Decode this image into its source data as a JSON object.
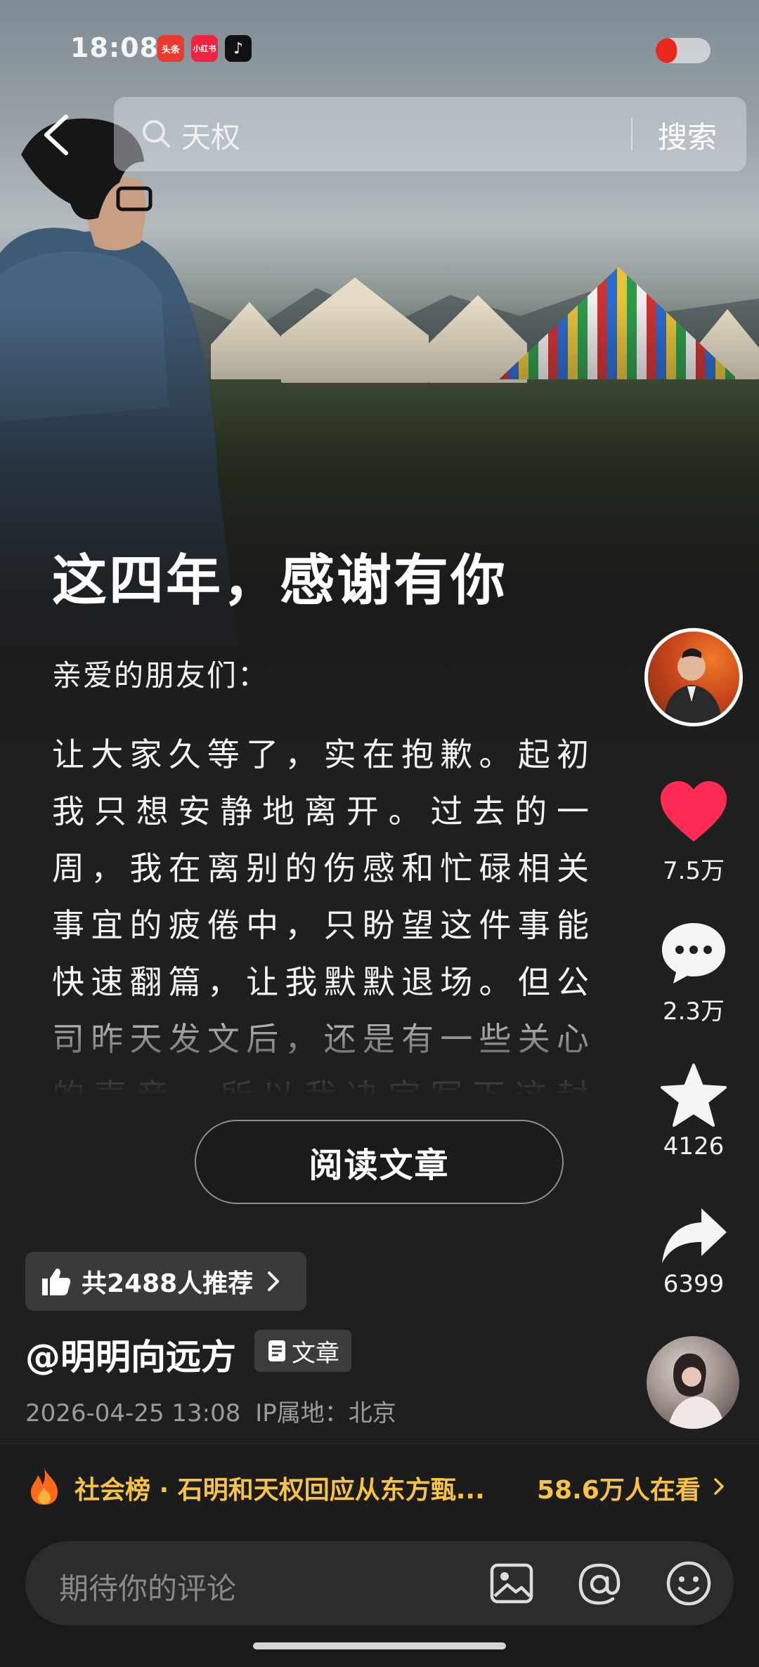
{
  "status_bar": {
    "time": "18:08",
    "app_icons": [
      {
        "name": "news-app-icon",
        "label": "头条",
        "color": "#e83a2f"
      },
      {
        "name": "xiaohongshu-icon",
        "label": "小红书",
        "color": "#ee2440"
      },
      {
        "name": "douyin-icon",
        "label": "♪",
        "color": "#111111"
      }
    ]
  },
  "search": {
    "query": "天权",
    "button": "搜索"
  },
  "article": {
    "title": "这四年，感谢有你",
    "greeting": "亲爱的朋友们：",
    "body": "让大家久等了，实在抱歉。起初我只想安静地离开。过去的一周，我在离别的伤感和忙碌相关事宜的疲倦中，只盼望这件事能快速翻篇，让我默默退场。但公司昨天发文后，还是有一些关心的声音，所以我决定写下这封信，正式告别大家。",
    "read_button": "阅读文章"
  },
  "actions": {
    "likes": "7.5万",
    "comments": "2.3万",
    "favorites": "4126",
    "shares": "6399"
  },
  "post": {
    "recommend": "共2488人推荐",
    "author": "@明明向远方",
    "tag": "文章",
    "datetime": "2026-04-25 13:08",
    "ip_location": "IP属地：北京"
  },
  "hot": {
    "text": "社会榜 · 石明和天权回应从东方甄...",
    "count": "58.6万人在看"
  },
  "comment": {
    "placeholder": "期待你的评论"
  },
  "colors": {
    "like": "#fe2c55",
    "hot": "#f6c346",
    "flame": "#ff6a1a",
    "background": "#1f1f1f"
  }
}
